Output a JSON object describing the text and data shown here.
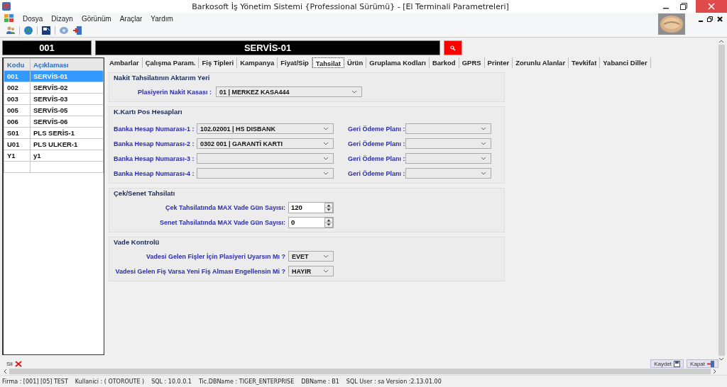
{
  "window": {
    "title": "Barkosoft İş Yönetim Sistemi {Professional Sürümü} - [El Terminali Parametreleri]"
  },
  "menu": [
    "Dosya",
    "Dizayn",
    "Görünüm",
    "Araçlar",
    "Yardım"
  ],
  "header": {
    "code": "001",
    "name": "SERVİS-01"
  },
  "list": {
    "columns": [
      "Kodu",
      "Açıklaması"
    ],
    "rows": [
      {
        "code": "001",
        "name": "SERVİS-01",
        "selected": true
      },
      {
        "code": "002",
        "name": "SERVİS-02",
        "selected": false
      },
      {
        "code": "003",
        "name": "SERVİS-03",
        "selected": false
      },
      {
        "code": "005",
        "name": "SERVİS-05",
        "selected": false
      },
      {
        "code": "006",
        "name": "SERVİS-06",
        "selected": false
      },
      {
        "code": "S01",
        "name": "PLS SERİS-1",
        "selected": false
      },
      {
        "code": "U01",
        "name": "PLS ULKER-1",
        "selected": false
      },
      {
        "code": "Y1",
        "name": "y1",
        "selected": false
      }
    ]
  },
  "tabs": [
    {
      "label": "Ambarlar",
      "selected": false
    },
    {
      "label": "Çalışma Param.",
      "selected": false
    },
    {
      "label": "Fiş Tipleri",
      "selected": false
    },
    {
      "label": "Kampanya",
      "selected": false
    },
    {
      "label": "Fiyat/Sip",
      "selected": false
    },
    {
      "label": "Tahsilat",
      "selected": true
    },
    {
      "label": "Ürün",
      "selected": false
    },
    {
      "label": "Gruplama Kodları",
      "selected": false
    },
    {
      "label": "Barkod",
      "selected": false
    },
    {
      "label": "GPRS",
      "selected": false
    },
    {
      "label": "Printer",
      "selected": false
    },
    {
      "label": "Zorunlu Alanlar",
      "selected": false
    },
    {
      "label": "Tevkifat",
      "selected": false
    },
    {
      "label": "Yabanci Diller",
      "selected": false
    }
  ],
  "sections": [
    {
      "title": "Nakit Tahsilatının Aktarım Yeri",
      "fields": [
        {
          "kind": "select",
          "label": "Plasiyerin Nakit Kasası :",
          "value": "01 | MERKEZ KASA444"
        }
      ]
    },
    {
      "title": "K.Kartı Pos Hesapları",
      "fields": [
        {
          "kind": "pair",
          "label": "Banka Hesap Numarası-1 :",
          "value": "102.02001 | HS DISBANK",
          "label_2": "Geri Ödeme Planı :"
        },
        {
          "kind": "pair",
          "label": "Banka Hesap Numarası-2 :",
          "value": "0302  001 | GARANTİ KARTI",
          "label_2": "Geri Ödeme Planı :"
        },
        {
          "kind": "pair",
          "label": "Banka Hesap Numarası-3 :",
          "label_2": "Geri Ödeme Planı :"
        },
        {
          "kind": "pair",
          "label": "Banka Hesap Numarası-4 :",
          "label_2": "Geri Ödeme Planı :"
        }
      ]
    },
    {
      "title": "Çek/Senet Tahsilatı",
      "fields": [
        {
          "kind": "spin",
          "label": "Çek Tahsilatında MAX Vade Gün Sayısı:",
          "value": "120"
        },
        {
          "kind": "spin",
          "label": "Senet Tahsilatında MAX Vade Gün Sayısı:",
          "value": "0"
        }
      ]
    },
    {
      "title": "Vade Kontrolü",
      "fields": [
        {
          "kind": "select",
          "label": "Vadesi Gelen Fişler İçin Plasiyeri Uyarsın Mı ?",
          "value": "EVET"
        },
        {
          "kind": "select",
          "label": "Vadesi Gelen Fiş Varsa Yeni Fiş Alması Engellensin Mi ?",
          "value": "HAYIR"
        }
      ]
    }
  ],
  "bottom_buttons": [
    "Sil",
    "Kaydet",
    "Kapat"
  ],
  "status_bar": [
    "Firma : [001] [05]  TEST",
    "Kullanici : ( OTOROUTE )",
    "SQL : 10.0.0.1",
    "Tic.DBName : TIGER_ENTERPRISE",
    "DBName : B1",
    "SQL User : sa  Version :2.13.01.00"
  ]
}
